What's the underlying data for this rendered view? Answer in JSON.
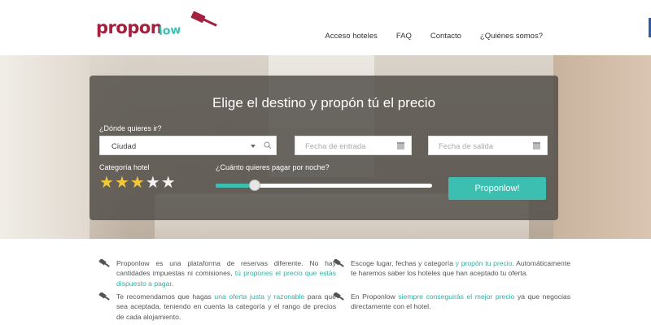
{
  "brand": {
    "name_part1": "propon",
    "name_part2": "low",
    "primary_color": "#a3213e",
    "accent_color": "#3cbfb1"
  },
  "nav": {
    "items": [
      "Acceso hoteles",
      "FAQ",
      "Contacto",
      "¿Quiénes somos?"
    ]
  },
  "search": {
    "title": "Elige el destino y propón tú el precio",
    "destination_label": "¿Dónde quieres ir?",
    "city_value": "Ciudad",
    "checkin_placeholder": "Fecha de entrada",
    "checkout_placeholder": "Fecha de salida",
    "category_label": "Categoría hotel",
    "category_stars": 3,
    "category_max": 5,
    "price_label": "¿Cuánto quieres pagar por noche?",
    "price_slider_fraction": 0.18,
    "submit_label": "Proponlow!"
  },
  "info": {
    "item1": {
      "pre": "Proponlow es una plataforma de reservas diferente. No hay cantidades impuestas ni comisiones, ",
      "highlight": "tú propones el precio que estás dispuesto a pagar",
      "post": "."
    },
    "item2": {
      "pre": "Te recomendamos que hagas ",
      "highlight": "una oferta justa y razonable",
      "post": " para que sea aceptada, teniendo en cuenta la categoría y el rango de precios de cada alojamiento."
    },
    "item3": {
      "pre": "Escoge lugar, fechas y categoría ",
      "highlight": "y propón tu precio",
      "post": ". Automáticamente te haremos saber los hoteles que han aceptado tu oferta."
    },
    "item4": {
      "pre": "En Proponlow ",
      "highlight": "siempre conseguirás el mejor precio",
      "post": " ya que negocias directamente con el hotel."
    }
  }
}
